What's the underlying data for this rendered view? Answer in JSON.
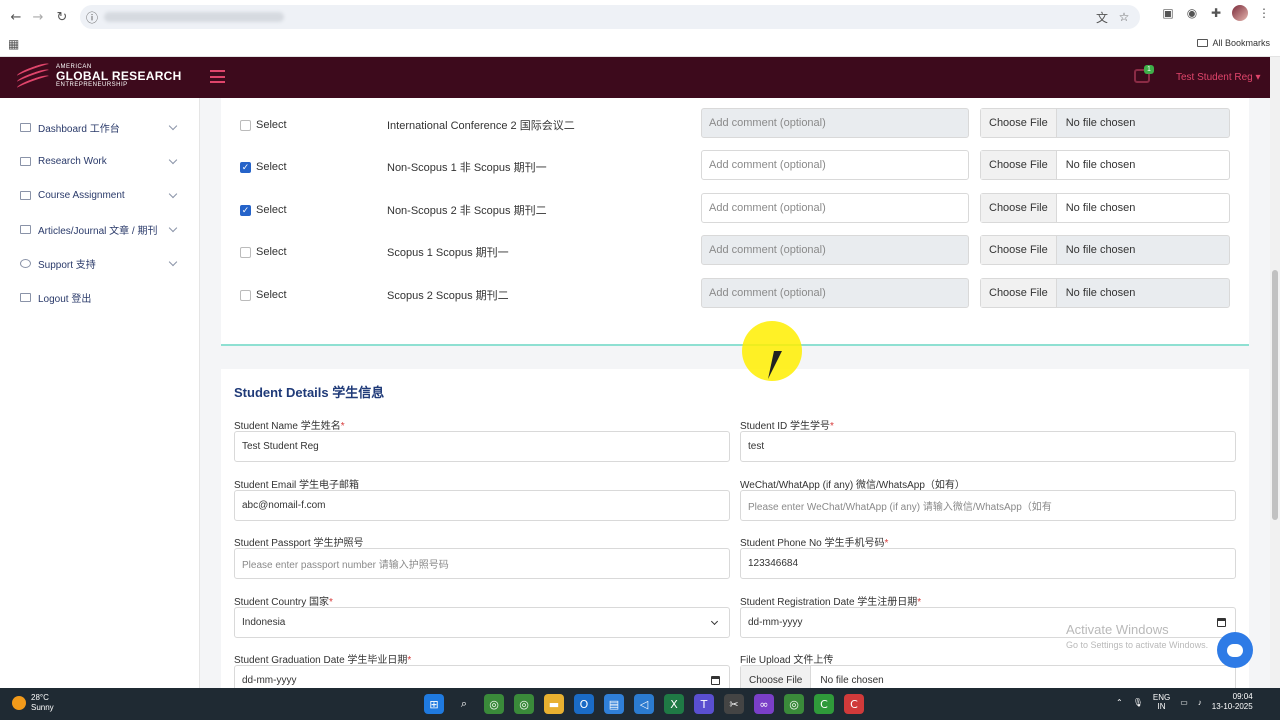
{
  "browser": {
    "all_bookmarks": "All Bookmarks"
  },
  "header": {
    "logo_small": "AMERICAN",
    "logo_big": "GLOBAL RESEARCH",
    "logo_sub": "ENTREPRENEURSHIP",
    "message_count": "1",
    "user": "Test Student Reg ▾"
  },
  "sidebar": {
    "items": [
      {
        "label": "Dashboard 工作台"
      },
      {
        "label": "Research Work"
      },
      {
        "label": "Course Assignment"
      },
      {
        "label": "Articles/Journal 文章 / 期刊"
      },
      {
        "label": "Support 支持"
      },
      {
        "label": "Logout 登出"
      }
    ]
  },
  "documents": {
    "select_label": "Select",
    "comment_placeholder": "Add comment (optional)",
    "choose_file": "Choose File",
    "no_file": "No file chosen",
    "rows": [
      {
        "name": "International Conference 2 国际会议二",
        "checked": false
      },
      {
        "name": "Non-Scopus 1 非 Scopus 期刊一",
        "checked": true
      },
      {
        "name": "Non-Scopus 2 非 Scopus 期刊二",
        "checked": true
      },
      {
        "name": "Scopus 1 Scopus 期刊一",
        "checked": false
      },
      {
        "name": "Scopus 2 Scopus 期刊二",
        "checked": false
      }
    ]
  },
  "student": {
    "title": "Student Details 学生信息",
    "name_label": "Student Name 学生姓名",
    "name_value": "Test Student Reg",
    "id_label": "Student ID 学生学号",
    "id_value": "test",
    "email_label": "Student Email 学生电子邮箱",
    "email_value": "abc@nomail-f.com",
    "wechat_label": "WeChat/WhatApp (if any) 微信/WhatsApp（如有）",
    "wechat_placeholder": "Please enter WeChat/WhatApp (if any) 请输入微信/WhatsApp（如有",
    "passport_label": "Student Passport 学生护照号",
    "passport_placeholder": "Please enter passport number 请输入护照号码",
    "phone_label": "Student Phone No 学生手机号码",
    "phone_value": "123346684",
    "country_label": "Student Country 国家",
    "country_value": "Indonesia",
    "regdate_label": "Student Registration Date 学生注册日期",
    "regdate_value": "dd-mm-yyyy",
    "graddate_label": "Student Graduation Date 学生毕业日期",
    "graddate_value": "dd-mm-yyyy",
    "upload_label": "File Upload 文件上传",
    "upload_button": "Choose File",
    "upload_status": "No file chosen",
    "required_mark": "*"
  },
  "watermark": {
    "line1": "Activate Windows",
    "line2": "Go to Settings to activate Windows."
  },
  "taskbar": {
    "temp": "28°C",
    "weather": "Sunny",
    "lang1": "ENG",
    "lang2": "IN",
    "time": "09:04",
    "date": "13-10-2025"
  }
}
